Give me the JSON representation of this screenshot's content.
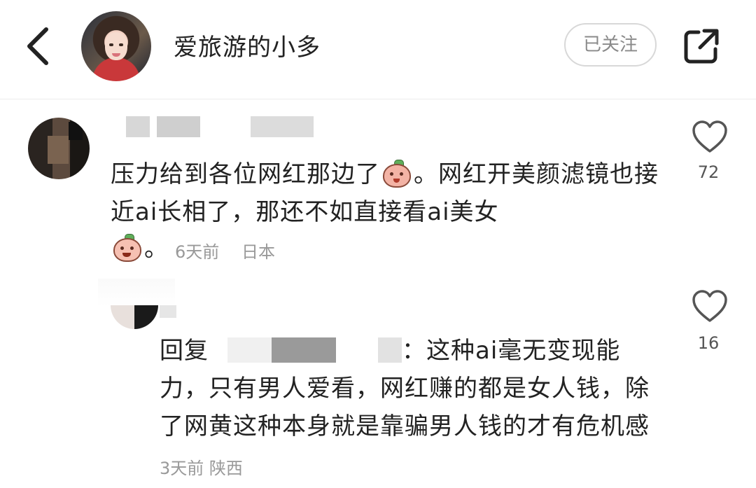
{
  "header": {
    "back_icon": "chevron-left-icon",
    "username": "爱旅游的小多",
    "follow_label": "已关注",
    "share_icon": "share-external-icon"
  },
  "comments": [
    {
      "text_before_emoji": "压力给到各位网红那边了",
      "text_after_emoji": "。网红开美颜滤镜也接近ai长相了，那还不如直接看ai美女",
      "trailing_punct": "。",
      "emoji_1": "peach-shy-emoji",
      "emoji_2": "peach-annoyed-emoji",
      "time": "6天前",
      "location": "日本",
      "likes": "72"
    },
    {
      "reply_prefix": "回复",
      "reply_suffix": "：这种ai毫无变现能力，只有男人爱看，网红赚的都是女人钱，除了网黄这种本身就是靠骗男人钱的才有危机感",
      "time": "3天前",
      "location": "陕西",
      "likes": "16"
    }
  ],
  "icons": {
    "like": "heart-outline-icon"
  },
  "colors": {
    "text": "#222222",
    "meta": "#999999",
    "divider": "#ececec"
  }
}
